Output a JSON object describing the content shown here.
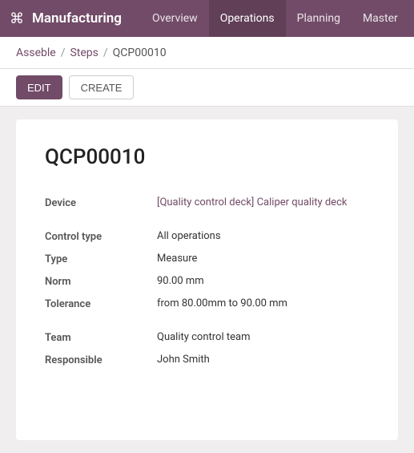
{
  "nav": {
    "brand": "Manufacturing",
    "links": [
      {
        "label": "Overview",
        "active": false
      },
      {
        "label": "Operations",
        "active": true
      },
      {
        "label": "Planning",
        "active": false
      },
      {
        "label": "Master",
        "active": false
      }
    ]
  },
  "breadcrumb": {
    "parent1": "Asseble",
    "sep1": "/",
    "parent2": "Steps",
    "sep2": "/",
    "current": "QCP00010"
  },
  "actions": {
    "edit_label": "EDIT",
    "create_label": "CREATE"
  },
  "record": {
    "title": "QCP00010",
    "fields": {
      "device_label": "Device",
      "device_value": "[Quality control deck] Caliper quality deck",
      "control_type_label": "Control type",
      "control_type_value": "All operations",
      "type_label": "Type",
      "type_value": "Measure",
      "norm_label": "Norm",
      "norm_value": "90.00 mm",
      "tolerance_label": "Tolerance",
      "tolerance_value": "from 80.00mm to 90.00 mm",
      "team_label": "Team",
      "team_value": "Quality control team",
      "responsible_label": "Responsible",
      "responsible_value": "John Smith"
    }
  }
}
